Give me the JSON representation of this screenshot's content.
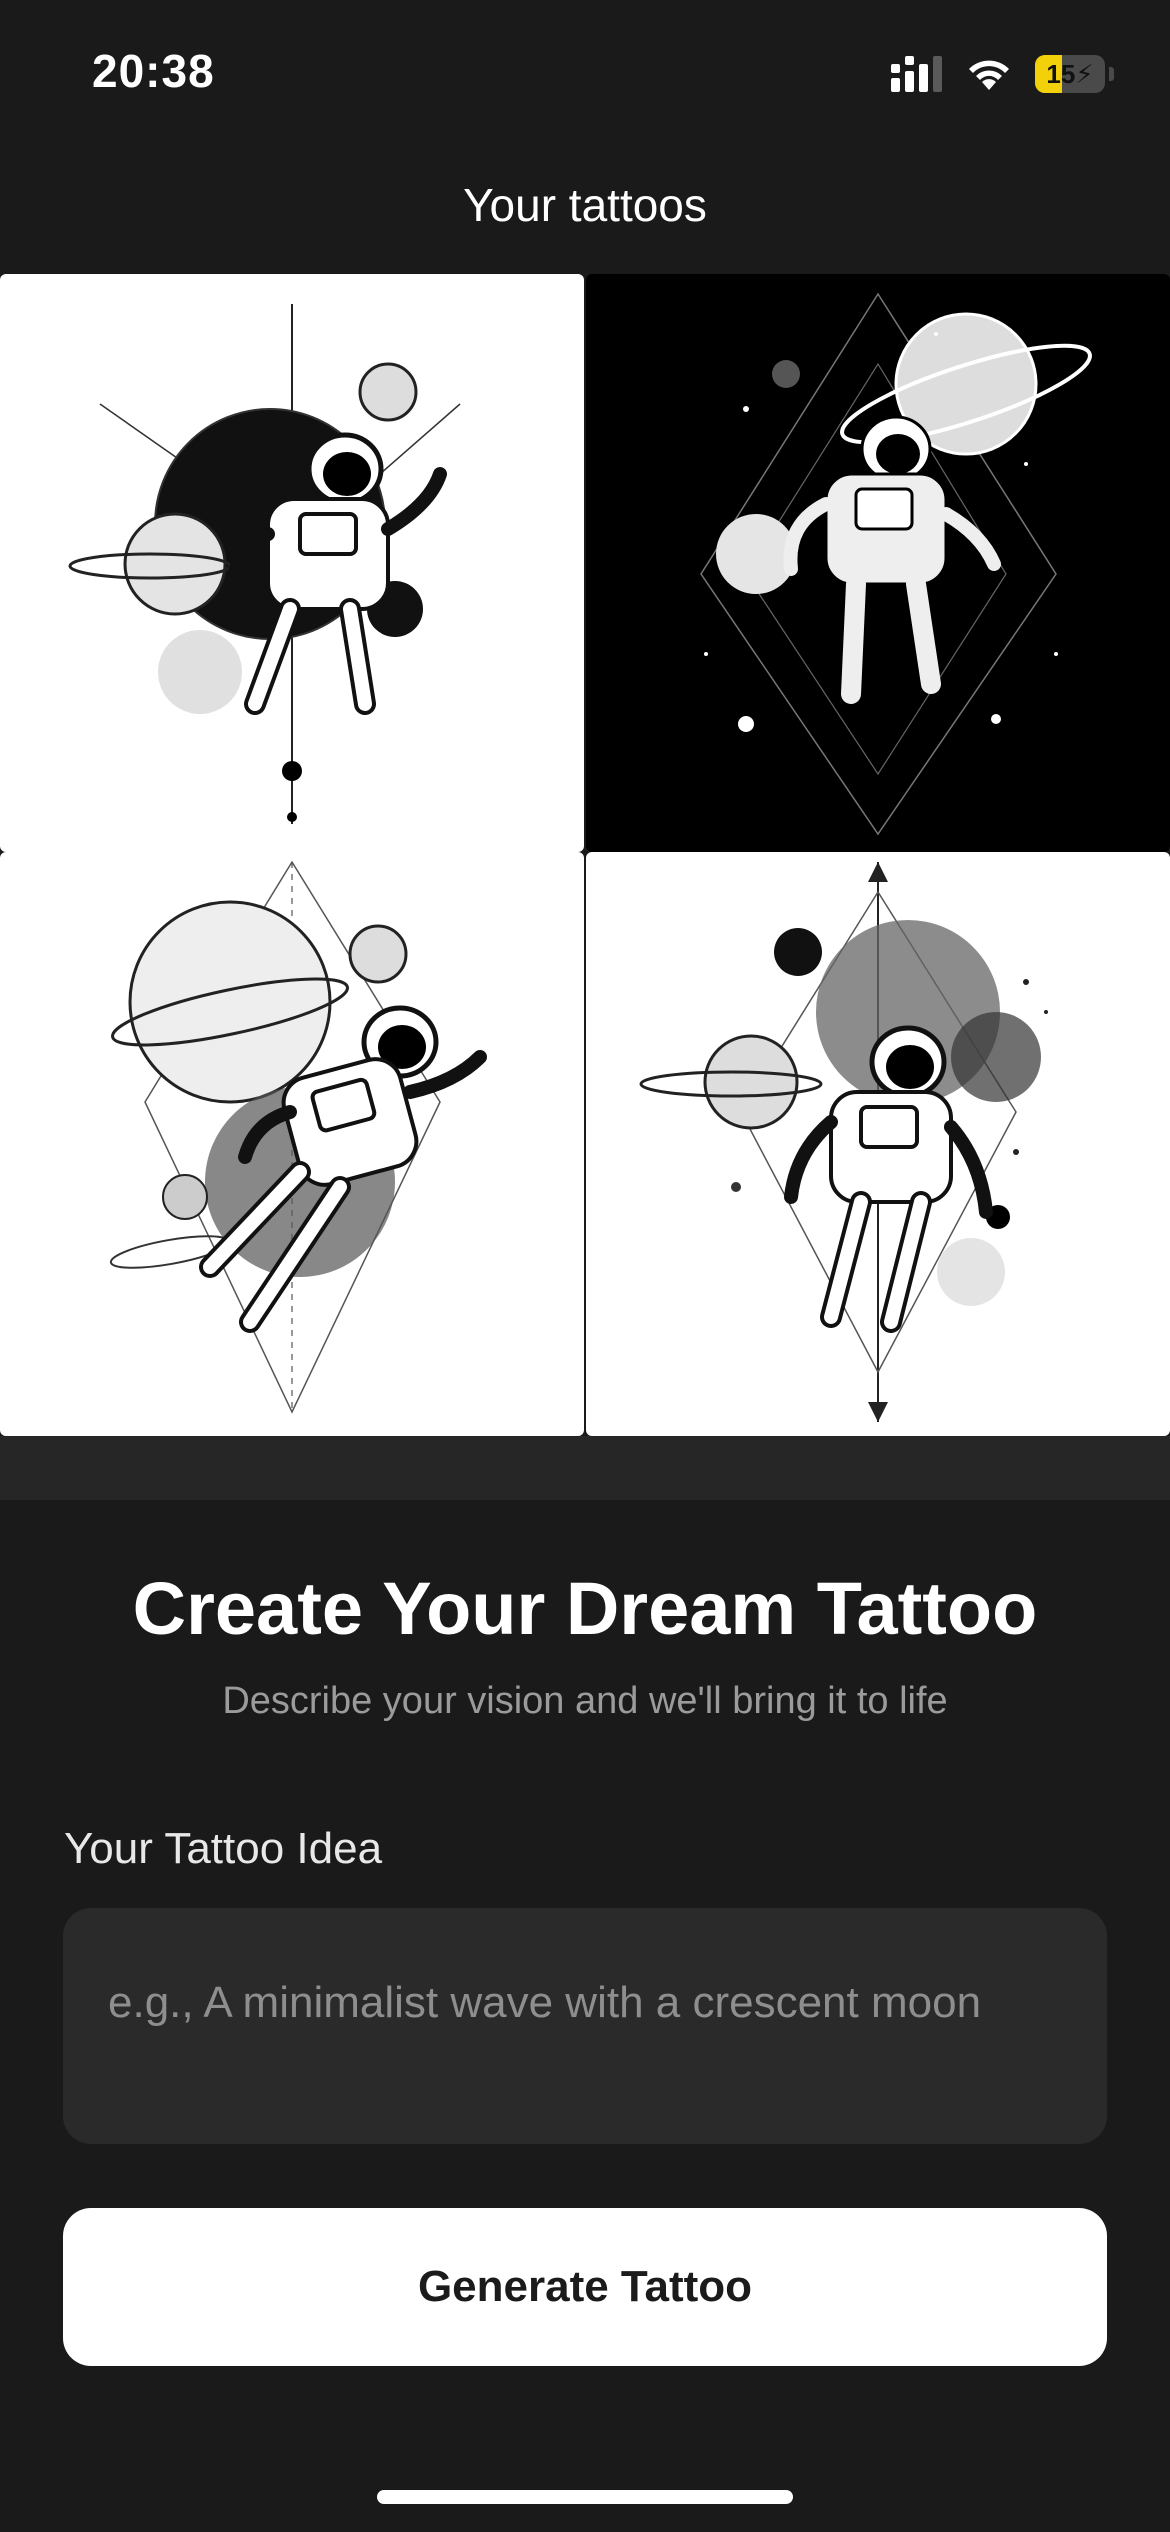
{
  "status_bar": {
    "time": "20:38",
    "battery_level": "15",
    "battery_color": "#f2d10b",
    "icons": [
      "signal-icon",
      "wifi-icon",
      "battery-charging-icon"
    ]
  },
  "header": {
    "title": "Your tattoos"
  },
  "gallery": {
    "items": [
      {
        "subject": "astronaut-tattoo",
        "style": "white background"
      },
      {
        "subject": "astronaut-tattoo",
        "style": "black background"
      },
      {
        "subject": "astronaut-tattoo",
        "style": "white background"
      },
      {
        "subject": "astronaut-tattoo",
        "style": "white background"
      }
    ]
  },
  "form": {
    "title": "Create Your Dream Tattoo",
    "subtitle": "Describe your vision and we'll bring it to life",
    "idea_label": "Your Tattoo Idea",
    "idea_placeholder": "e.g., A minimalist wave with a crescent moon",
    "idea_value": "",
    "generate_label": "Generate Tattoo"
  },
  "colors": {
    "background": "#1a1a1a",
    "input_background": "#2a2a2a",
    "button_background": "#ffffff",
    "button_text": "#1b1b1b",
    "muted_text": "#9b9b9b"
  }
}
